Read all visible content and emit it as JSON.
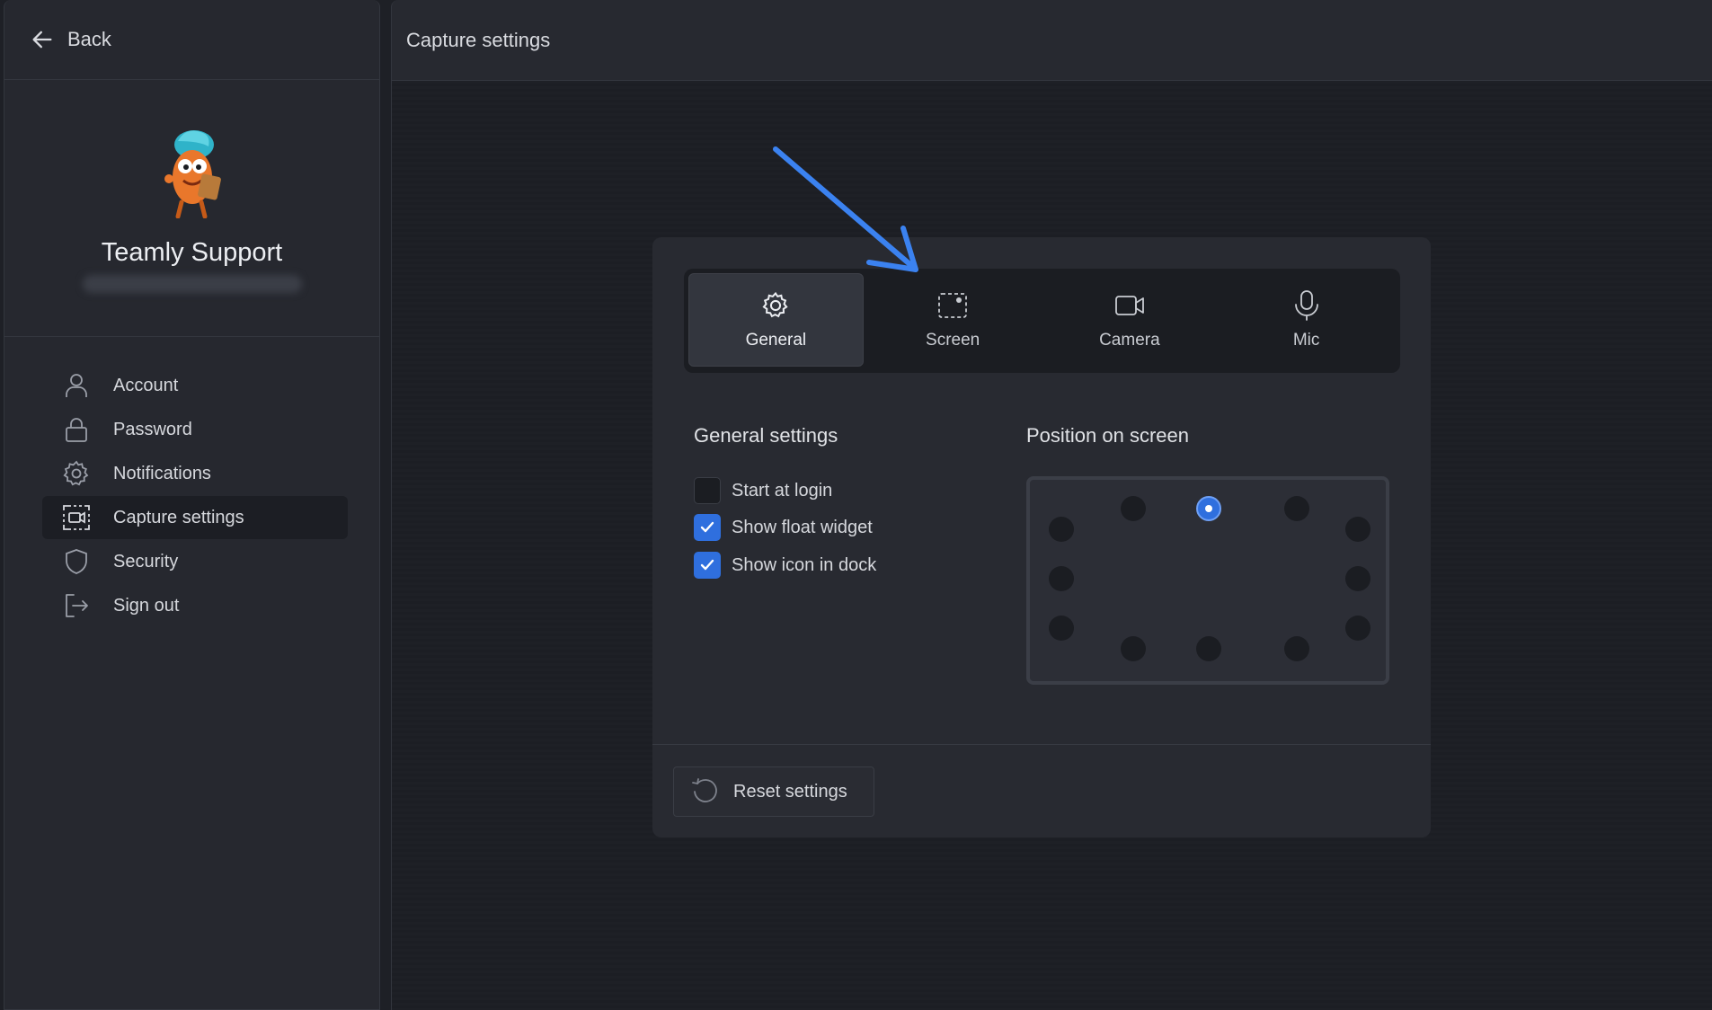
{
  "sidebar": {
    "back_label": "Back",
    "profile_name": "Teamly Support",
    "items": [
      {
        "label": "Account",
        "icon": "user-icon",
        "active": false
      },
      {
        "label": "Password",
        "icon": "lock-icon",
        "active": false
      },
      {
        "label": "Notifications",
        "icon": "gear-icon",
        "active": false
      },
      {
        "label": "Capture settings",
        "icon": "capture-icon",
        "active": true
      },
      {
        "label": "Security",
        "icon": "shield-icon",
        "active": false
      },
      {
        "label": "Sign out",
        "icon": "sign-out-icon",
        "active": false
      }
    ]
  },
  "header": {
    "title": "Capture settings"
  },
  "tabs": [
    {
      "label": "General",
      "icon": "gear-icon",
      "active": true
    },
    {
      "label": "Screen",
      "icon": "screen-select-icon",
      "active": false
    },
    {
      "label": "Camera",
      "icon": "camera-icon",
      "active": false
    },
    {
      "label": "Mic",
      "icon": "mic-icon",
      "active": false
    }
  ],
  "general": {
    "title": "General settings",
    "options": [
      {
        "label": "Start at login",
        "checked": false
      },
      {
        "label": "Show float widget",
        "checked": true
      },
      {
        "label": "Show icon in dock",
        "checked": true
      }
    ]
  },
  "position": {
    "title": "Position on screen",
    "selected": "top-center"
  },
  "footer": {
    "reset_label": "Reset settings"
  },
  "colors": {
    "accent": "#2f6fde",
    "annotation_arrow": "#3b82f0",
    "background": "#1e2026",
    "panel": "#282a31"
  }
}
